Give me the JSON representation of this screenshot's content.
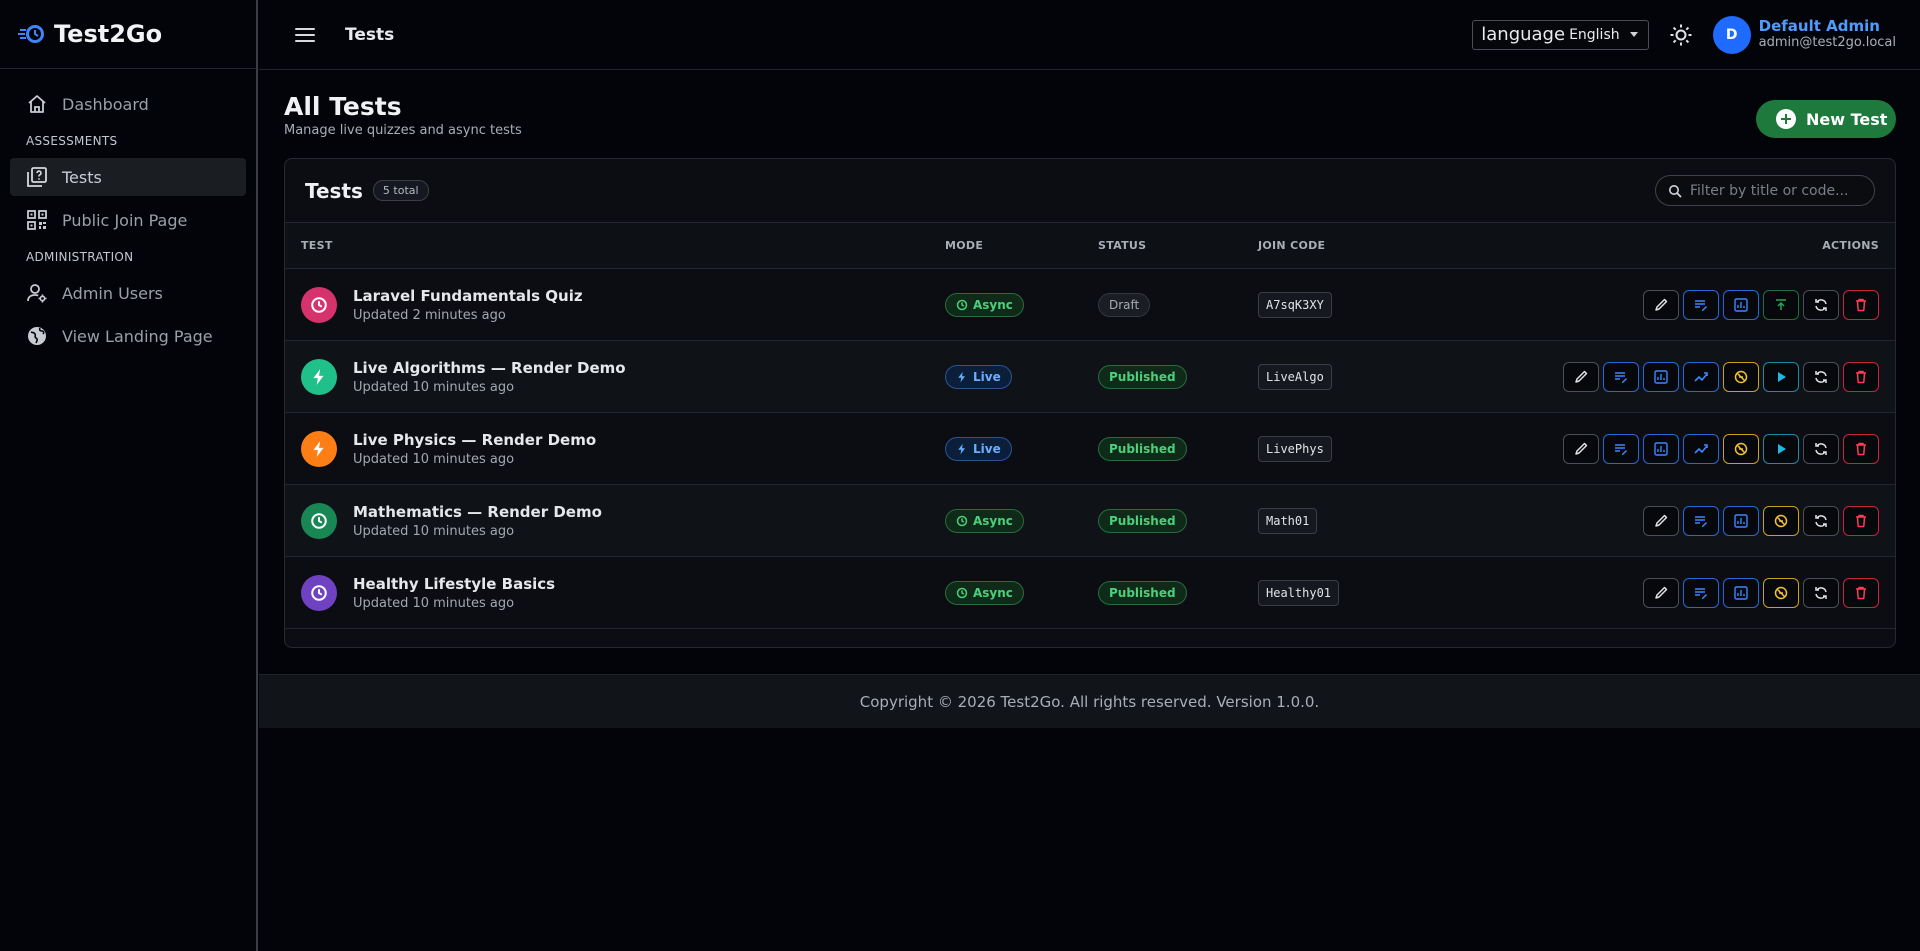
{
  "brand": {
    "name": "Test2Go"
  },
  "sidebar": {
    "dashboard": "Dashboard",
    "section_assessments": "ASSESSMENTS",
    "tests": "Tests",
    "public_join": "Public Join Page",
    "section_admin": "ADMINISTRATION",
    "admin_users": "Admin Users",
    "landing": "View Landing Page"
  },
  "topbar": {
    "title": "Tests",
    "language_label": "language",
    "language_value": "English",
    "user_initial": "D",
    "user_name": "Default Admin",
    "user_email": "admin@test2go.local"
  },
  "page": {
    "title": "All Tests",
    "subtitle": "Manage live quizzes and async tests",
    "new_button": "New Test"
  },
  "card": {
    "title": "Tests",
    "count": "5 total",
    "filter_placeholder": "Filter by title or code..."
  },
  "table": {
    "headers": {
      "test": "TEST",
      "mode": "MODE",
      "status": "STATUS",
      "code": "JOIN CODE",
      "actions": "ACTIONS"
    },
    "rows": [
      {
        "title": "Laravel Fundamentals Quiz",
        "updated": "Updated 2 minutes ago",
        "mode": "Async",
        "status": "Draft",
        "code": "A7sqK3XY",
        "icon_color": "#d6336c",
        "icon": "clock-icon"
      },
      {
        "title": "Live Algorithms — Render Demo",
        "updated": "Updated 10 minutes ago",
        "mode": "Live",
        "status": "Published",
        "code": "LiveAlgo",
        "icon_color": "#1fc08a",
        "icon": "bolt-icon"
      },
      {
        "title": "Live Physics — Render Demo",
        "updated": "Updated 10 minutes ago",
        "mode": "Live",
        "status": "Published",
        "code": "LivePhys",
        "icon_color": "#fd7e14",
        "icon": "bolt-icon"
      },
      {
        "title": "Mathematics — Render Demo",
        "updated": "Updated 10 minutes ago",
        "mode": "Async",
        "status": "Published",
        "code": "Math01",
        "icon_color": "#198754",
        "icon": "clock-icon"
      },
      {
        "title": "Healthy Lifestyle Basics",
        "updated": "Updated 10 minutes ago",
        "mode": "Async",
        "status": "Published",
        "code": "Healthy01",
        "icon_color": "#6f42c1",
        "icon": "clock-icon"
      }
    ]
  },
  "footer": {
    "text": "Copyright © 2026 Test2Go. All rights reserved. Version 1.0.0."
  }
}
